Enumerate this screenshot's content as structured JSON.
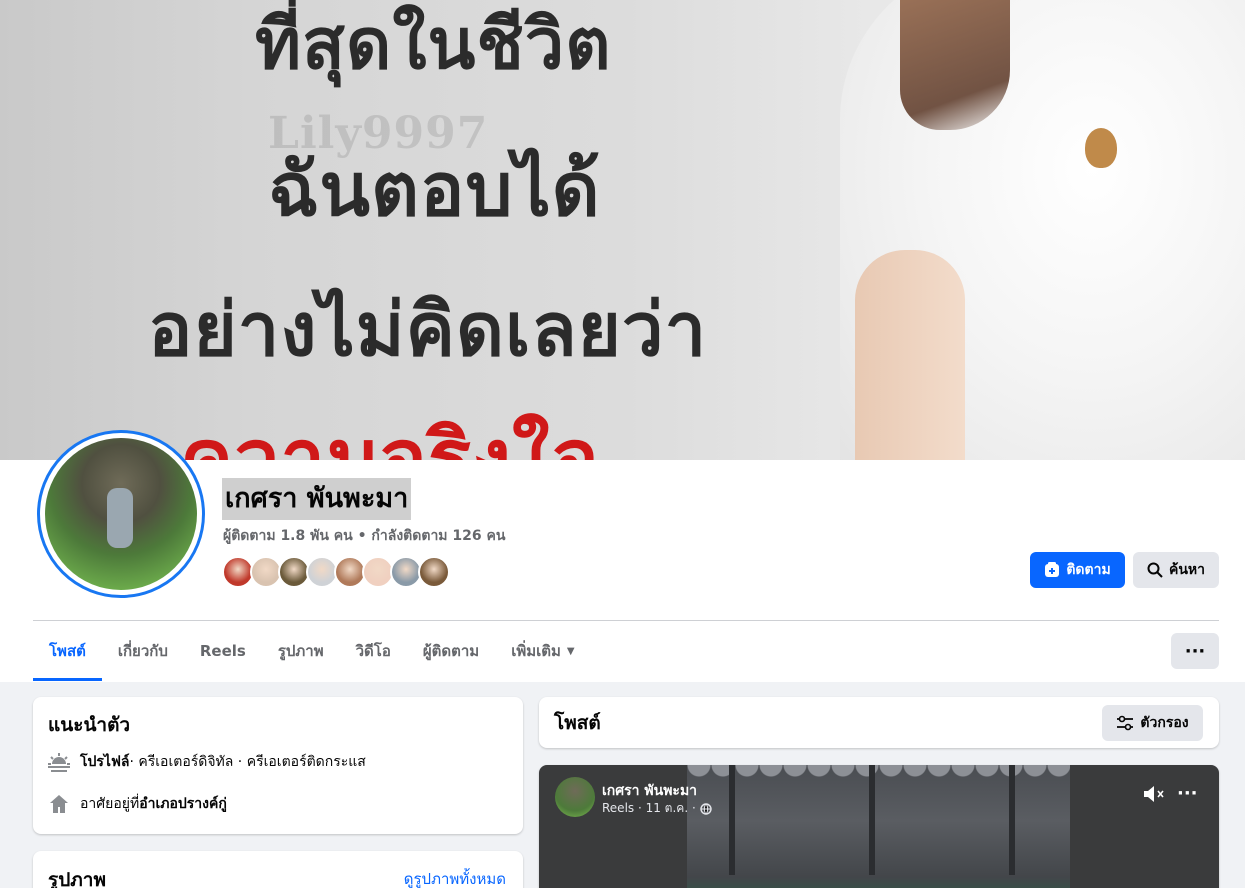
{
  "cover": {
    "line1": "ที่สุดในชีวิต",
    "line2": "ฉันตอบได้",
    "line3": "อย่างไม่คิดเลยว่า",
    "line4": "ความจริงใจ",
    "watermark": "Lily9997"
  },
  "profile": {
    "name": "เกศรา พันพะมา",
    "stats": "ผู้ติดตาม 1.8 พัน คน • กำลังติดตาม 126 คน",
    "follower_avatar_colors": [
      "#c0392b",
      "#d9c3b0",
      "#6b5a3a",
      "#cfd2d6",
      "#b07a5a",
      "#f0d0c0",
      "#8a9aa8",
      "#7a5a3a"
    ]
  },
  "actions": {
    "follow_label": "ติดตาม",
    "search_label": "ค้นหา"
  },
  "tabs": [
    {
      "label": "โพสต์"
    },
    {
      "label": "เกี่ยวกับ"
    },
    {
      "label": "Reels"
    },
    {
      "label": "รูปภาพ"
    },
    {
      "label": "วิดีโอ"
    },
    {
      "label": "ผู้ติดตาม"
    },
    {
      "label": "เพิ่มเติม"
    }
  ],
  "more_options": "···",
  "intro": {
    "title": "แนะนำตัว",
    "profile_label": "โปรไฟล์",
    "profile_detail": " · ครีเอเตอร์ดิจิทัล · ครีเอเตอร์ติดกระแส",
    "lives_prefix": "อาศัยอยู่ที่ ",
    "lives_place": "อำเภอปรางค์กู่"
  },
  "photos": {
    "title": "รูปภาพ",
    "see_all": "ดูรูปภาพทั้งหมด"
  },
  "posts": {
    "title": "โพสต์",
    "filter_label": "ตัวกรอง"
  },
  "reel": {
    "author": "เกศรา พันพะมา",
    "meta": "Reels · 11 ต.ค. ·",
    "more": "···"
  },
  "colors": {
    "accent": "#0866ff",
    "avatar_ring": "#1877f2",
    "cover_highlight": "#d01818"
  }
}
